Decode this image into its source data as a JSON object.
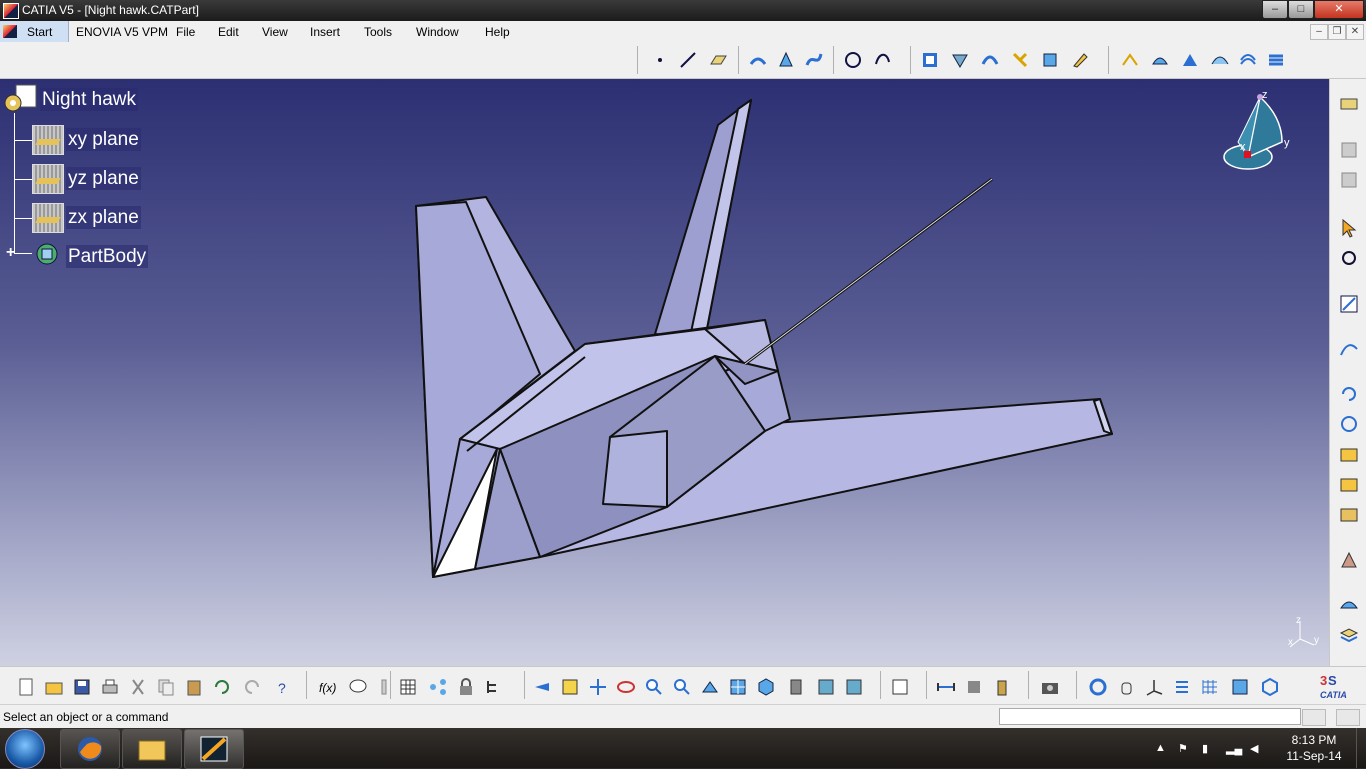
{
  "window": {
    "title": "CATIA V5 - [Night hawk.CATPart]",
    "min": "–",
    "max": "□",
    "close": "✕"
  },
  "menu": {
    "start": "Start",
    "items": [
      "ENOVIA V5 VPM",
      "File",
      "Edit",
      "View",
      "Insert",
      "Tools",
      "Window",
      "Help"
    ]
  },
  "tree": {
    "root": "Night hawk",
    "items": [
      {
        "label": "xy plane"
      },
      {
        "label": "yz plane"
      },
      {
        "label": "zx plane"
      },
      {
        "label": "PartBody",
        "expand": "+"
      }
    ]
  },
  "compass": {
    "z": "z",
    "y": "y",
    "x": "x"
  },
  "axis_triad": {
    "z": "z",
    "x": "x",
    "y": "y"
  },
  "status": {
    "message": "Select an object or a command",
    "input_value": ""
  },
  "taskbar": {
    "time": "8:13 PM",
    "date": "11-Sep-14"
  },
  "colors": {
    "accent": "#cfe0f5",
    "viewport_top": "#2c2f72",
    "viewport_bottom": "#cfd1e2",
    "model_fill": "#b3b5e0"
  },
  "icons": {
    "start_orb": "windows-start-icon",
    "firefox": "firefox-icon",
    "explorer": "folder-icon",
    "catia": "catia-icon",
    "brand": "catia-logo"
  }
}
